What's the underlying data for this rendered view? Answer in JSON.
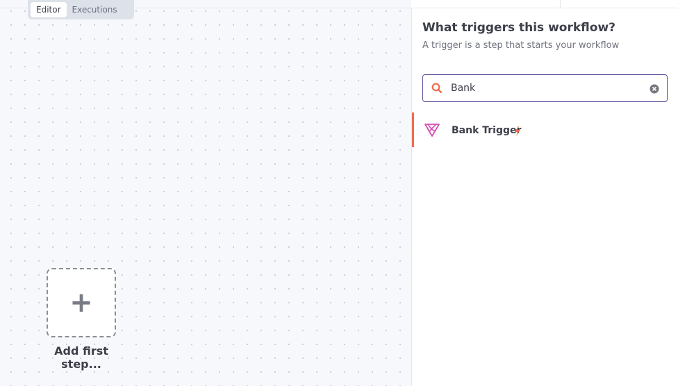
{
  "header": {
    "tabs": [
      {
        "label": "Editor",
        "active": true
      },
      {
        "label": "Executions",
        "active": false
      }
    ]
  },
  "canvas": {
    "add_step_label": "Add first step...",
    "add_icon": "plus-icon"
  },
  "panel": {
    "title": "What triggers this workflow?",
    "subtitle": "A trigger is a step that starts your workflow",
    "search": {
      "value": "Bank",
      "icon": "search-icon",
      "clear_icon": "clear-circle-icon"
    },
    "results": [
      {
        "label": "Bank Trigger",
        "icon": "bank-triangle-icon",
        "badge_icon": "lightning-bolt-icon"
      }
    ]
  },
  "colors": {
    "accent": "#ee6c4d",
    "search_border": "#5b4f9e",
    "result_icon": "#d54cb1"
  }
}
